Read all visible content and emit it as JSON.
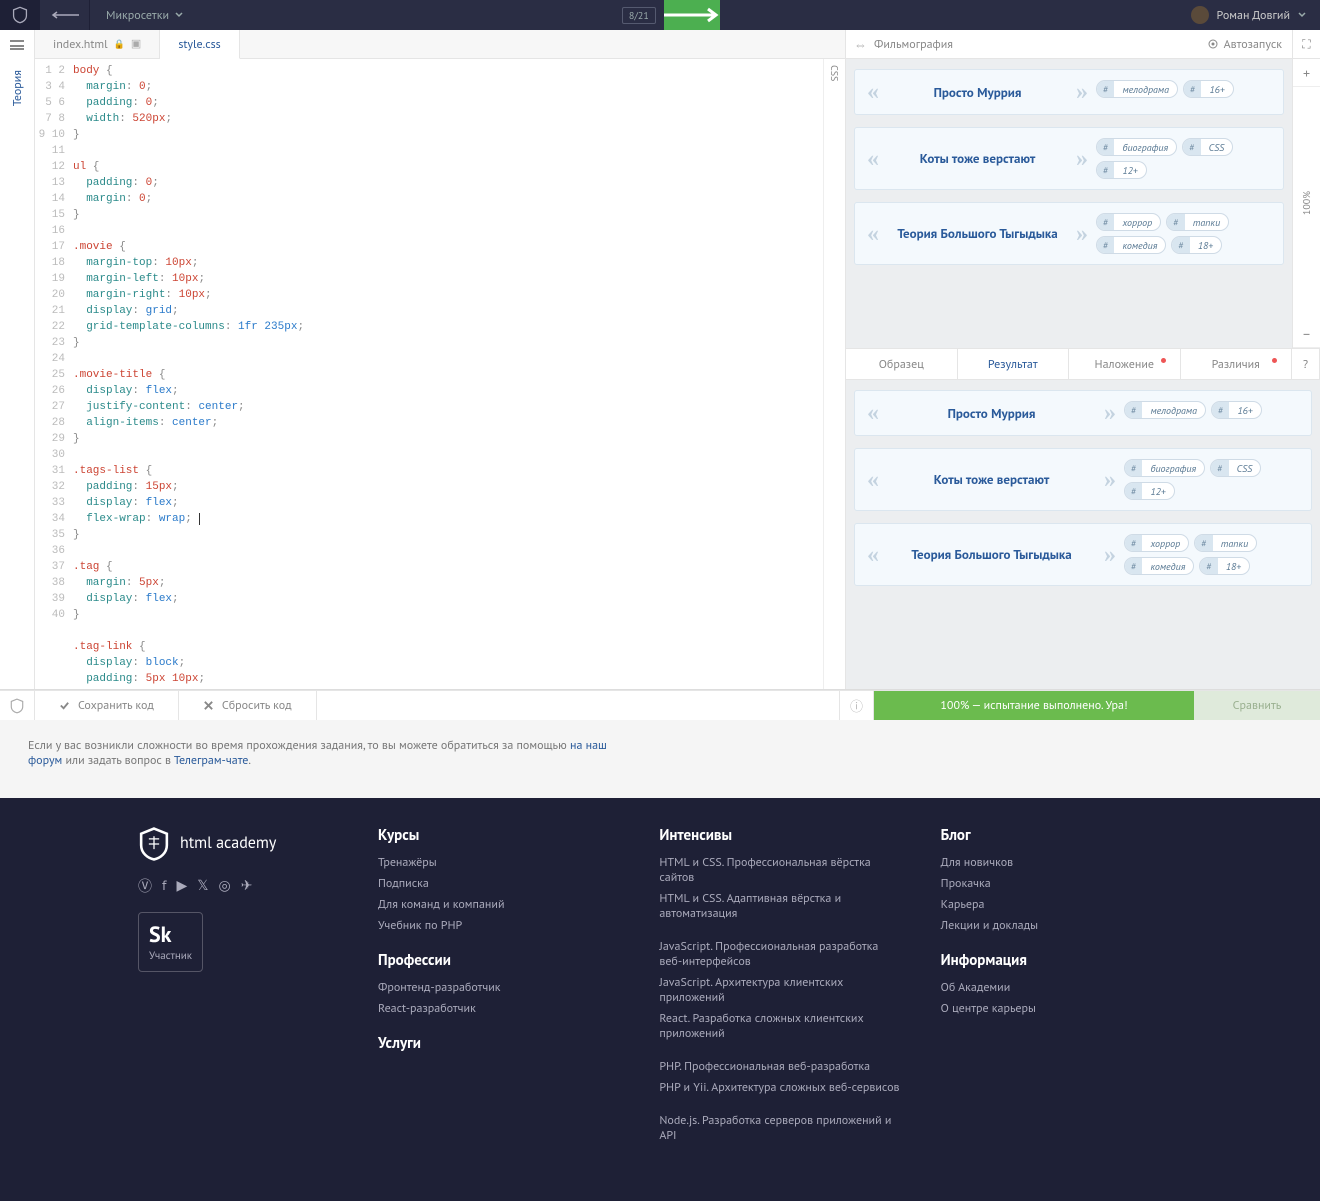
{
  "topbar": {
    "breadcrumb": "Микросетки",
    "counter": "8/21",
    "user": "Роман Довгий"
  },
  "theory_label": "Теория",
  "tabs": [
    {
      "label": "index.html",
      "locked": true,
      "active": false
    },
    {
      "label": "style.css",
      "locked": false,
      "active": true
    }
  ],
  "side_lang": "CSS",
  "code_lines": [
    [
      [
        "sel",
        "body"
      ],
      [
        "p",
        " {"
      ]
    ],
    [
      [
        "p",
        "  "
      ],
      [
        "prop",
        "margin"
      ],
      [
        "p",
        ": "
      ],
      [
        "num",
        "0"
      ],
      [
        "p",
        ";"
      ]
    ],
    [
      [
        "p",
        "  "
      ],
      [
        "prop",
        "padding"
      ],
      [
        "p",
        ": "
      ],
      [
        "num",
        "0"
      ],
      [
        "p",
        ";"
      ]
    ],
    [
      [
        "p",
        "  "
      ],
      [
        "prop",
        "width"
      ],
      [
        "p",
        ": "
      ],
      [
        "num",
        "520px"
      ],
      [
        "p",
        ";"
      ]
    ],
    [
      [
        "p",
        "}"
      ]
    ],
    [],
    [
      [
        "sel",
        "ul"
      ],
      [
        "p",
        " {"
      ]
    ],
    [
      [
        "p",
        "  "
      ],
      [
        "prop",
        "padding"
      ],
      [
        "p",
        ": "
      ],
      [
        "num",
        "0"
      ],
      [
        "p",
        ";"
      ]
    ],
    [
      [
        "p",
        "  "
      ],
      [
        "prop",
        "margin"
      ],
      [
        "p",
        ": "
      ],
      [
        "num",
        "0"
      ],
      [
        "p",
        ";"
      ]
    ],
    [
      [
        "p",
        "}"
      ]
    ],
    [],
    [
      [
        "sel",
        ".movie"
      ],
      [
        "p",
        " {"
      ]
    ],
    [
      [
        "p",
        "  "
      ],
      [
        "prop",
        "margin-top"
      ],
      [
        "p",
        ": "
      ],
      [
        "num",
        "10px"
      ],
      [
        "p",
        ";"
      ]
    ],
    [
      [
        "p",
        "  "
      ],
      [
        "prop",
        "margin-left"
      ],
      [
        "p",
        ": "
      ],
      [
        "num",
        "10px"
      ],
      [
        "p",
        ";"
      ]
    ],
    [
      [
        "p",
        "  "
      ],
      [
        "prop",
        "margin-right"
      ],
      [
        "p",
        ": "
      ],
      [
        "num",
        "10px"
      ],
      [
        "p",
        ";"
      ]
    ],
    [
      [
        "p",
        "  "
      ],
      [
        "prop",
        "display"
      ],
      [
        "p",
        ": "
      ],
      [
        "val",
        "grid"
      ],
      [
        "p",
        ";"
      ]
    ],
    [
      [
        "p",
        "  "
      ],
      [
        "prop",
        "grid-template-columns"
      ],
      [
        "p",
        ": "
      ],
      [
        "val",
        "1fr 235px"
      ],
      [
        "p",
        ";"
      ]
    ],
    [
      [
        "p",
        "}"
      ]
    ],
    [],
    [
      [
        "sel",
        ".movie-title"
      ],
      [
        "p",
        " {"
      ]
    ],
    [
      [
        "p",
        "  "
      ],
      [
        "prop",
        "display"
      ],
      [
        "p",
        ": "
      ],
      [
        "val",
        "flex"
      ],
      [
        "p",
        ";"
      ]
    ],
    [
      [
        "p",
        "  "
      ],
      [
        "prop",
        "justify-content"
      ],
      [
        "p",
        ": "
      ],
      [
        "val",
        "center"
      ],
      [
        "p",
        ";"
      ]
    ],
    [
      [
        "p",
        "  "
      ],
      [
        "prop",
        "align-items"
      ],
      [
        "p",
        ": "
      ],
      [
        "val",
        "center"
      ],
      [
        "p",
        ";"
      ]
    ],
    [
      [
        "p",
        "}"
      ]
    ],
    [],
    [
      [
        "sel",
        ".tags-list"
      ],
      [
        "p",
        " {"
      ]
    ],
    [
      [
        "p",
        "  "
      ],
      [
        "prop",
        "padding"
      ],
      [
        "p",
        ": "
      ],
      [
        "num",
        "15px"
      ],
      [
        "p",
        ";"
      ]
    ],
    [
      [
        "p",
        "  "
      ],
      [
        "prop",
        "display"
      ],
      [
        "p",
        ": "
      ],
      [
        "val",
        "flex"
      ],
      [
        "p",
        ";"
      ]
    ],
    [
      [
        "p",
        "  "
      ],
      [
        "prop",
        "flex-wrap"
      ],
      [
        "p",
        ": "
      ],
      [
        "val",
        "wrap"
      ],
      [
        "p",
        "; "
      ],
      [
        "cur",
        ""
      ]
    ],
    [
      [
        "p",
        "}"
      ]
    ],
    [],
    [
      [
        "sel",
        ".tag"
      ],
      [
        "p",
        " {"
      ]
    ],
    [
      [
        "p",
        "  "
      ],
      [
        "prop",
        "margin"
      ],
      [
        "p",
        ": "
      ],
      [
        "num",
        "5px"
      ],
      [
        "p",
        ";"
      ]
    ],
    [
      [
        "p",
        "  "
      ],
      [
        "prop",
        "display"
      ],
      [
        "p",
        ": "
      ],
      [
        "val",
        "flex"
      ],
      [
        "p",
        ";"
      ]
    ],
    [
      [
        "p",
        "}"
      ]
    ],
    [],
    [
      [
        "sel",
        ".tag-link"
      ],
      [
        "p",
        " {"
      ]
    ],
    [
      [
        "p",
        "  "
      ],
      [
        "prop",
        "display"
      ],
      [
        "p",
        ": "
      ],
      [
        "val",
        "block"
      ],
      [
        "p",
        ";"
      ]
    ],
    [
      [
        "p",
        "  "
      ],
      [
        "prop",
        "padding"
      ],
      [
        "p",
        ": "
      ],
      [
        "num",
        "5px 10px"
      ],
      [
        "p",
        ";"
      ]
    ],
    [
      [
        "p",
        "}"
      ]
    ]
  ],
  "preview": {
    "title": "Фильмография",
    "autorun": "Автозапуск",
    "zoom": "100%",
    "movies": [
      {
        "title": "Просто Муррия",
        "tags": [
          "мелодрама",
          "16+"
        ]
      },
      {
        "title": "Коты тоже верстают",
        "tags": [
          "биография",
          "CSS",
          "12+"
        ]
      },
      {
        "title": "Теория Большого Тыгыдыка",
        "tags": [
          "хоррор",
          "тапки",
          "комедия",
          "18+"
        ]
      }
    ]
  },
  "result_tabs": [
    "Образец",
    "Результат",
    "Наложение",
    "Различия",
    "?"
  ],
  "result_active": 1,
  "bottom": {
    "save": "Сохранить код",
    "reset": "Сбросить код",
    "status": "100% — испытание выполнено. Ура!",
    "compare": "Сравнить"
  },
  "hint": {
    "pre": "Если у вас возникли сложности во время прохождения задания, то вы можете обратиться за помощью ",
    "forum": "на наш форум",
    "mid": " или задать вопрос в ",
    "tg": "Телеграм-чате",
    "post": "."
  },
  "footer": {
    "brand": "html academy",
    "sk": {
      "big": "Sk",
      "small": "Участник"
    },
    "cols": [
      {
        "title": "Курсы",
        "links": [
          "Тренажёры",
          "Подписка",
          "Для команд и компаний",
          "Учебник по PHP"
        ]
      },
      {
        "title": "Профессии",
        "links": [
          "Фронтенд-разработчик",
          "React-разработчик"
        ]
      },
      {
        "title": "Услуги",
        "links": []
      },
      {
        "title": "Интенсивы",
        "links": [
          "HTML и CSS. Профессиональная вёрстка сайтов",
          "HTML и CSS. Адаптивная вёрстка и автоматизация",
          "",
          "JavaScript. Профессиональная разработка веб-интерфейсов",
          "JavaScript. Архитектура клиентских приложений",
          "React. Разработка сложных клиентских приложений",
          "",
          "PHP. Профессиональная веб-разработка",
          "PHP и Yii. Архитектура сложных веб-сервисов",
          "",
          "Node.js. Разработка серверов приложений и API"
        ]
      },
      {
        "title": "Блог",
        "links": [
          "Для новичков",
          "Прокачка",
          "Карьера",
          "Лекции и доклады"
        ]
      },
      {
        "title": "Информация",
        "links": [
          "Об Академии",
          "О центре карьеры"
        ]
      }
    ]
  }
}
